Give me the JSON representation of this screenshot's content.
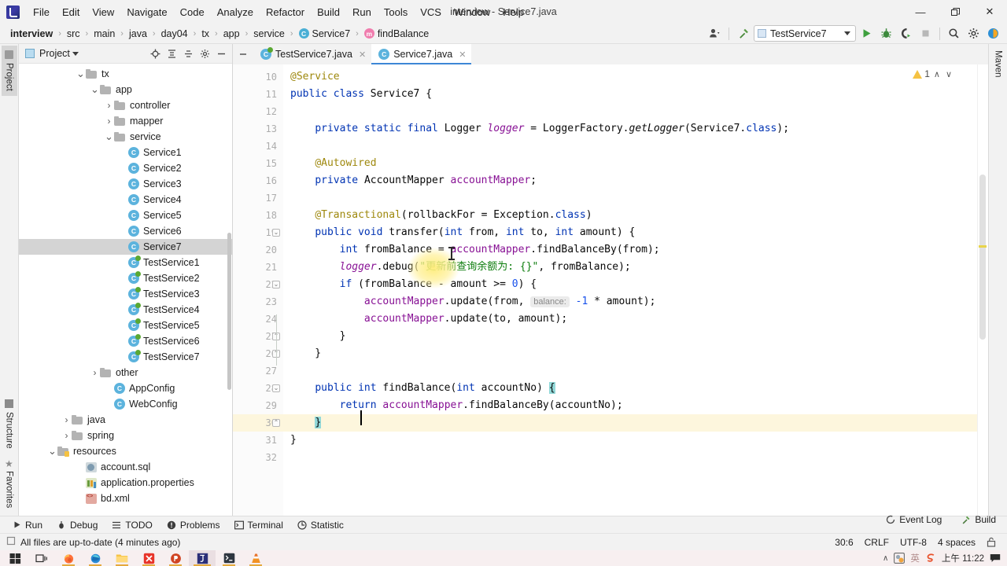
{
  "window": {
    "title": "interview - Service7.java",
    "minimize": "—",
    "maximize": "❐",
    "close": "✕"
  },
  "menubar": {
    "items": [
      {
        "label": "File"
      },
      {
        "label": "Edit"
      },
      {
        "label": "View"
      },
      {
        "label": "Navigate"
      },
      {
        "label": "Code"
      },
      {
        "label": "Analyze"
      },
      {
        "label": "Refactor"
      },
      {
        "label": "Build"
      },
      {
        "label": "Run"
      },
      {
        "label": "Tools"
      },
      {
        "label": "VCS"
      },
      {
        "label": "Window"
      },
      {
        "label": "Help"
      }
    ]
  },
  "breadcrumb": {
    "sep": "›",
    "items": [
      {
        "label": "interview",
        "icon": "none",
        "bold": true
      },
      {
        "label": "src",
        "icon": "none",
        "bold": false
      },
      {
        "label": "main",
        "icon": "none",
        "bold": false
      },
      {
        "label": "java",
        "icon": "none",
        "bold": false
      },
      {
        "label": "day04",
        "icon": "none",
        "bold": false
      },
      {
        "label": "tx",
        "icon": "none",
        "bold": false
      },
      {
        "label": "app",
        "icon": "none",
        "bold": false
      },
      {
        "label": "service",
        "icon": "none",
        "bold": false
      },
      {
        "label": "Service7",
        "icon": "class-icon",
        "bold": false
      },
      {
        "label": "findBalance",
        "icon": "method-icon",
        "bold": false
      }
    ]
  },
  "toolbar": {
    "run_configuration": "TestService7",
    "buttons": [
      {
        "name": "user-settings-icon",
        "label": ""
      },
      {
        "name": "build-hammer-icon",
        "label": ""
      },
      {
        "name": "run-icon",
        "label": ""
      },
      {
        "name": "debug-icon",
        "label": ""
      },
      {
        "name": "run-with-coverage-icon",
        "label": ""
      },
      {
        "name": "stop-icon",
        "label": ""
      },
      {
        "name": "search-everywhere-icon",
        "label": ""
      },
      {
        "name": "settings-gear-icon",
        "label": ""
      },
      {
        "name": "ide-assistant-icon",
        "label": ""
      }
    ]
  },
  "left_rail": {
    "top": [
      {
        "label": "Project",
        "active": true
      }
    ],
    "bottom": [
      {
        "label": "Structure",
        "active": false
      },
      {
        "label": "Favorites",
        "active": false
      }
    ]
  },
  "right_rail": {
    "items": [
      {
        "label": "Maven",
        "active": false
      }
    ]
  },
  "project_panel": {
    "title": "Project",
    "tools": [
      "locate-icon",
      "expand-all-icon",
      "collapse-all-icon",
      "settings-icon",
      "hide-icon"
    ],
    "tree": [
      {
        "label": "tx",
        "indent": 4,
        "arrow": "down",
        "icon": "folder",
        "selected": false
      },
      {
        "label": "app",
        "indent": 5,
        "arrow": "down",
        "icon": "folder",
        "selected": false
      },
      {
        "label": "controller",
        "indent": 6,
        "arrow": "right",
        "icon": "folder",
        "selected": false
      },
      {
        "label": "mapper",
        "indent": 6,
        "arrow": "right",
        "icon": "folder",
        "selected": false
      },
      {
        "label": "service",
        "indent": 6,
        "arrow": "down",
        "icon": "folder",
        "selected": false
      },
      {
        "label": "Service1",
        "indent": 7,
        "arrow": "none",
        "icon": "class",
        "selected": false
      },
      {
        "label": "Service2",
        "indent": 7,
        "arrow": "none",
        "icon": "class",
        "selected": false
      },
      {
        "label": "Service3",
        "indent": 7,
        "arrow": "none",
        "icon": "class",
        "selected": false
      },
      {
        "label": "Service4",
        "indent": 7,
        "arrow": "none",
        "icon": "class",
        "selected": false
      },
      {
        "label": "Service5",
        "indent": 7,
        "arrow": "none",
        "icon": "class",
        "selected": false
      },
      {
        "label": "Service6",
        "indent": 7,
        "arrow": "none",
        "icon": "class",
        "selected": false
      },
      {
        "label": "Service7",
        "indent": 7,
        "arrow": "none",
        "icon": "class",
        "selected": true
      },
      {
        "label": "TestService1",
        "indent": 7,
        "arrow": "none",
        "icon": "testclass",
        "selected": false
      },
      {
        "label": "TestService2",
        "indent": 7,
        "arrow": "none",
        "icon": "testclass",
        "selected": false
      },
      {
        "label": "TestService3",
        "indent": 7,
        "arrow": "none",
        "icon": "testclass",
        "selected": false
      },
      {
        "label": "TestService4",
        "indent": 7,
        "arrow": "none",
        "icon": "testclass",
        "selected": false
      },
      {
        "label": "TestService5",
        "indent": 7,
        "arrow": "none",
        "icon": "testclass",
        "selected": false
      },
      {
        "label": "TestService6",
        "indent": 7,
        "arrow": "none",
        "icon": "testclass",
        "selected": false
      },
      {
        "label": "TestService7",
        "indent": 7,
        "arrow": "none",
        "icon": "testclass",
        "selected": false
      },
      {
        "label": "other",
        "indent": 5,
        "arrow": "right",
        "icon": "folder",
        "selected": false
      },
      {
        "label": "AppConfig",
        "indent": 6,
        "arrow": "none",
        "icon": "class",
        "selected": false
      },
      {
        "label": "WebConfig",
        "indent": 6,
        "arrow": "none",
        "icon": "class",
        "selected": false
      },
      {
        "label": "java",
        "indent": 3,
        "arrow": "right",
        "icon": "folder",
        "selected": false
      },
      {
        "label": "spring",
        "indent": 3,
        "arrow": "right",
        "icon": "folder",
        "selected": false
      },
      {
        "label": "resources",
        "indent": 2,
        "arrow": "down",
        "icon": "resfolder",
        "selected": false
      },
      {
        "label": "account.sql",
        "indent": 4,
        "arrow": "none",
        "icon": "sql",
        "selected": false
      },
      {
        "label": "application.properties",
        "indent": 4,
        "arrow": "none",
        "icon": "properties",
        "selected": false
      },
      {
        "label": "bd.xml",
        "indent": 4,
        "arrow": "none",
        "icon": "xml",
        "selected": false
      }
    ]
  },
  "editor": {
    "tabs": [
      {
        "label": "TestService7.java",
        "icon": "testclass-icon",
        "active": false,
        "close": "✕"
      },
      {
        "label": "Service7.java",
        "icon": "class-icon",
        "active": true,
        "close": "✕"
      }
    ],
    "inspection": {
      "warning_count": "1",
      "up": "∧",
      "down": "∨"
    },
    "first_line_number": 10,
    "lines": [
      {
        "n": 10,
        "cur": false,
        "fold": "none",
        "tokens": [
          {
            "t": "@Service",
            "c": "ann"
          }
        ]
      },
      {
        "n": 11,
        "cur": false,
        "fold": "none",
        "tokens": [
          {
            "t": "public ",
            "c": "kw"
          },
          {
            "t": "class ",
            "c": "kw"
          },
          {
            "t": "Service7 {",
            "c": "pl"
          }
        ]
      },
      {
        "n": 12,
        "cur": false,
        "fold": "none",
        "tokens": []
      },
      {
        "n": 13,
        "cur": false,
        "fold": "none",
        "tokens": [
          {
            "t": "    ",
            "c": "pl"
          },
          {
            "t": "private static final ",
            "c": "kw"
          },
          {
            "t": "Logger ",
            "c": "pl"
          },
          {
            "t": "logger",
            "c": "fld ital"
          },
          {
            "t": " = LoggerFactory.",
            "c": "pl"
          },
          {
            "t": "getLogger",
            "c": "pl ital"
          },
          {
            "t": "(Service7.",
            "c": "pl"
          },
          {
            "t": "class",
            "c": "kw"
          },
          {
            "t": ");",
            "c": "pl"
          }
        ]
      },
      {
        "n": 14,
        "cur": false,
        "fold": "none",
        "tokens": []
      },
      {
        "n": 15,
        "cur": false,
        "fold": "none",
        "tokens": [
          {
            "t": "    ",
            "c": "pl"
          },
          {
            "t": "@Autowired",
            "c": "ann"
          }
        ]
      },
      {
        "n": 16,
        "cur": false,
        "fold": "none",
        "tokens": [
          {
            "t": "    ",
            "c": "pl"
          },
          {
            "t": "private ",
            "c": "kw"
          },
          {
            "t": "AccountMapper ",
            "c": "pl"
          },
          {
            "t": "accountMapper",
            "c": "fld"
          },
          {
            "t": ";",
            "c": "pl"
          }
        ]
      },
      {
        "n": 17,
        "cur": false,
        "fold": "none",
        "tokens": []
      },
      {
        "n": 18,
        "cur": false,
        "fold": "none",
        "tokens": [
          {
            "t": "    ",
            "c": "pl"
          },
          {
            "t": "@Transactional",
            "c": "ann"
          },
          {
            "t": "(rollbackFor = Exception.",
            "c": "pl"
          },
          {
            "t": "class",
            "c": "kw"
          },
          {
            "t": ")",
            "c": "pl"
          }
        ]
      },
      {
        "n": 19,
        "cur": false,
        "fold": "open",
        "tokens": [
          {
            "t": "    ",
            "c": "pl"
          },
          {
            "t": "public void ",
            "c": "kw"
          },
          {
            "t": "transfer",
            "c": "pl"
          },
          {
            "t": "(",
            "c": "pl"
          },
          {
            "t": "int ",
            "c": "kw"
          },
          {
            "t": "from, ",
            "c": "pl"
          },
          {
            "t": "int ",
            "c": "kw"
          },
          {
            "t": "to, ",
            "c": "pl"
          },
          {
            "t": "int ",
            "c": "kw"
          },
          {
            "t": "amount) {",
            "c": "pl"
          }
        ]
      },
      {
        "n": 20,
        "cur": false,
        "fold": "none",
        "tokens": [
          {
            "t": "        ",
            "c": "pl"
          },
          {
            "t": "int ",
            "c": "kw"
          },
          {
            "t": "fromBalance = ",
            "c": "pl"
          },
          {
            "t": "accountMapper",
            "c": "fld"
          },
          {
            "t": ".findBalanceBy(from);",
            "c": "pl"
          }
        ]
      },
      {
        "n": 21,
        "cur": false,
        "fold": "none",
        "tokens": [
          {
            "t": "        ",
            "c": "pl"
          },
          {
            "t": "logger",
            "c": "fld ital"
          },
          {
            "t": ".debug(",
            "c": "pl"
          },
          {
            "t": "\"更新前查询余额为: {}\"",
            "c": "str"
          },
          {
            "t": ", fromBalance);",
            "c": "pl"
          }
        ]
      },
      {
        "n": 22,
        "cur": false,
        "fold": "open",
        "tokens": [
          {
            "t": "        ",
            "c": "pl"
          },
          {
            "t": "if ",
            "c": "kw"
          },
          {
            "t": "(fromBalance - amount >= ",
            "c": "pl"
          },
          {
            "t": "0",
            "c": "num"
          },
          {
            "t": ") {",
            "c": "pl"
          }
        ]
      },
      {
        "n": 23,
        "cur": false,
        "fold": "none",
        "tokens": [
          {
            "t": "            ",
            "c": "pl"
          },
          {
            "t": "accountMapper",
            "c": "fld"
          },
          {
            "t": ".update(from, ",
            "c": "pl"
          },
          {
            "t": "balance:",
            "c": "inlay"
          },
          {
            "t": " ",
            "c": "pl"
          },
          {
            "t": "-1",
            "c": "num"
          },
          {
            "t": " * amount);",
            "c": "pl"
          }
        ]
      },
      {
        "n": 24,
        "cur": false,
        "fold": "none",
        "tokens": [
          {
            "t": "            ",
            "c": "pl"
          },
          {
            "t": "accountMapper",
            "c": "fld"
          },
          {
            "t": ".update(to, amount);",
            "c": "pl"
          }
        ]
      },
      {
        "n": 25,
        "cur": false,
        "fold": "close",
        "tokens": [
          {
            "t": "        }",
            "c": "pl"
          }
        ]
      },
      {
        "n": 26,
        "cur": false,
        "fold": "close",
        "tokens": [
          {
            "t": "    }",
            "c": "pl"
          }
        ]
      },
      {
        "n": 27,
        "cur": false,
        "fold": "none",
        "tokens": []
      },
      {
        "n": 28,
        "cur": false,
        "fold": "open",
        "tokens": [
          {
            "t": "    ",
            "c": "pl"
          },
          {
            "t": "public int ",
            "c": "kw"
          },
          {
            "t": "findBalance",
            "c": "pl"
          },
          {
            "t": "(",
            "c": "pl"
          },
          {
            "t": "int ",
            "c": "kw"
          },
          {
            "t": "accountNo) ",
            "c": "pl"
          },
          {
            "t": "{",
            "c": "pl brace-hl"
          }
        ]
      },
      {
        "n": 29,
        "cur": false,
        "fold": "none",
        "tokens": [
          {
            "t": "        ",
            "c": "pl"
          },
          {
            "t": "return ",
            "c": "kw"
          },
          {
            "t": "accountMapper",
            "c": "fld"
          },
          {
            "t": ".findBalanceBy(accountNo);",
            "c": "pl"
          }
        ]
      },
      {
        "n": 30,
        "cur": true,
        "fold": "close",
        "tokens": [
          {
            "t": "    ",
            "c": "pl"
          },
          {
            "t": "}",
            "c": "pl brace-hl"
          }
        ]
      },
      {
        "n": 31,
        "cur": false,
        "fold": "none",
        "tokens": [
          {
            "t": "}",
            "c": "pl"
          }
        ]
      },
      {
        "n": 32,
        "cur": false,
        "fold": "none",
        "tokens": []
      }
    ]
  },
  "tool_windows": [
    {
      "label": "Run",
      "icon": "run-icon"
    },
    {
      "label": "Debug",
      "icon": "debug-icon"
    },
    {
      "label": "TODO",
      "icon": "todo-icon"
    },
    {
      "label": "Problems",
      "icon": "problems-icon"
    },
    {
      "label": "Terminal",
      "icon": "terminal-icon"
    },
    {
      "label": "Statistic",
      "icon": "statistic-icon"
    }
  ],
  "status_bar": {
    "message": "All files are up-to-date (4 minutes ago)",
    "event_log": "Event Log",
    "build": "Build",
    "caret_position": "30:6",
    "line_separator": "CRLF",
    "encoding": "UTF-8",
    "indent": "4 spaces",
    "lock_icon": "read-write-lock-icon"
  },
  "taskbar": {
    "items": [
      {
        "name": "start-button-icon",
        "active": false,
        "open": false
      },
      {
        "name": "task-view-icon",
        "active": false,
        "open": false
      },
      {
        "name": "firefox-icon",
        "active": false,
        "open": true
      },
      {
        "name": "edge-icon",
        "active": false,
        "open": true
      },
      {
        "name": "file-explorer-icon",
        "active": false,
        "open": true
      },
      {
        "name": "xmind-icon",
        "active": false,
        "open": true
      },
      {
        "name": "powerpoint-icon",
        "active": false,
        "open": true
      },
      {
        "name": "intellij-idea-icon",
        "active": true,
        "open": true
      },
      {
        "name": "terminal-icon",
        "active": false,
        "open": true
      },
      {
        "name": "vlc-icon",
        "active": false,
        "open": true
      }
    ],
    "tray": {
      "chevron": "∧",
      "ime_label": "英",
      "clock": "上午 11:22"
    }
  },
  "colors": {
    "accent": "#3d87d6",
    "keyword": "#0033b3",
    "annotation": "#9e880d",
    "string": "#0d7d0d",
    "number": "#1750eb",
    "field": "#871094",
    "warning": "#f5c242",
    "caret_line": "#fdf6dd",
    "brace_match": "#93d9d9"
  }
}
